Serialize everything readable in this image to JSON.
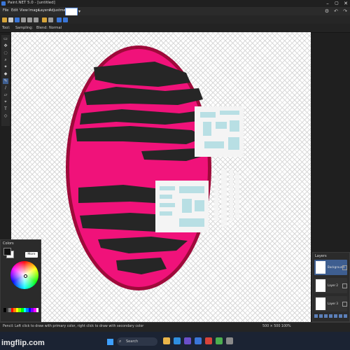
{
  "window": {
    "title": "Paint.NET 5.0 - [untitled]",
    "min_icon": "minimize-icon",
    "max_icon": "maximize-icon",
    "close_icon": "close-icon"
  },
  "menu": [
    "File",
    "Edit",
    "View",
    "Image",
    "Layers",
    "Adjustments",
    "Effects"
  ],
  "toolsettings": {
    "tool_label": "Tool:",
    "sampling_label": "Sampling:",
    "blend_label": "Blend:",
    "blend_value": "Normal"
  },
  "colors_panel": {
    "title": "Colors",
    "more_button": "More >>",
    "primary": "#111111",
    "secondary": "#ffffff",
    "palette": [
      "#000000",
      "#404040",
      "#808080",
      "#ff0000",
      "#ff8000",
      "#ffff00",
      "#80ff00",
      "#00ff00",
      "#00ffff",
      "#0080ff",
      "#0000ff",
      "#8000ff",
      "#ff00ff",
      "#ffffff"
    ]
  },
  "layers_panel": {
    "title": "Layers",
    "layers": [
      {
        "name": "Background"
      },
      {
        "name": "Layer 2"
      },
      {
        "name": "Layer 3"
      }
    ]
  },
  "status": {
    "left": "Pencil: Left click to draw with primary color, right click to draw with secondary color",
    "right": "500 × 500   100%"
  },
  "taskbar": {
    "search_label": "Search"
  },
  "watermark": "imgflip.com",
  "colors": {
    "accent": "#3a76d8",
    "artwork_pink": "#f0127a",
    "artwork_dark": "#262626",
    "artwork_outline": "#9e0a3a",
    "artwork_screen": "#b8dfe4"
  }
}
